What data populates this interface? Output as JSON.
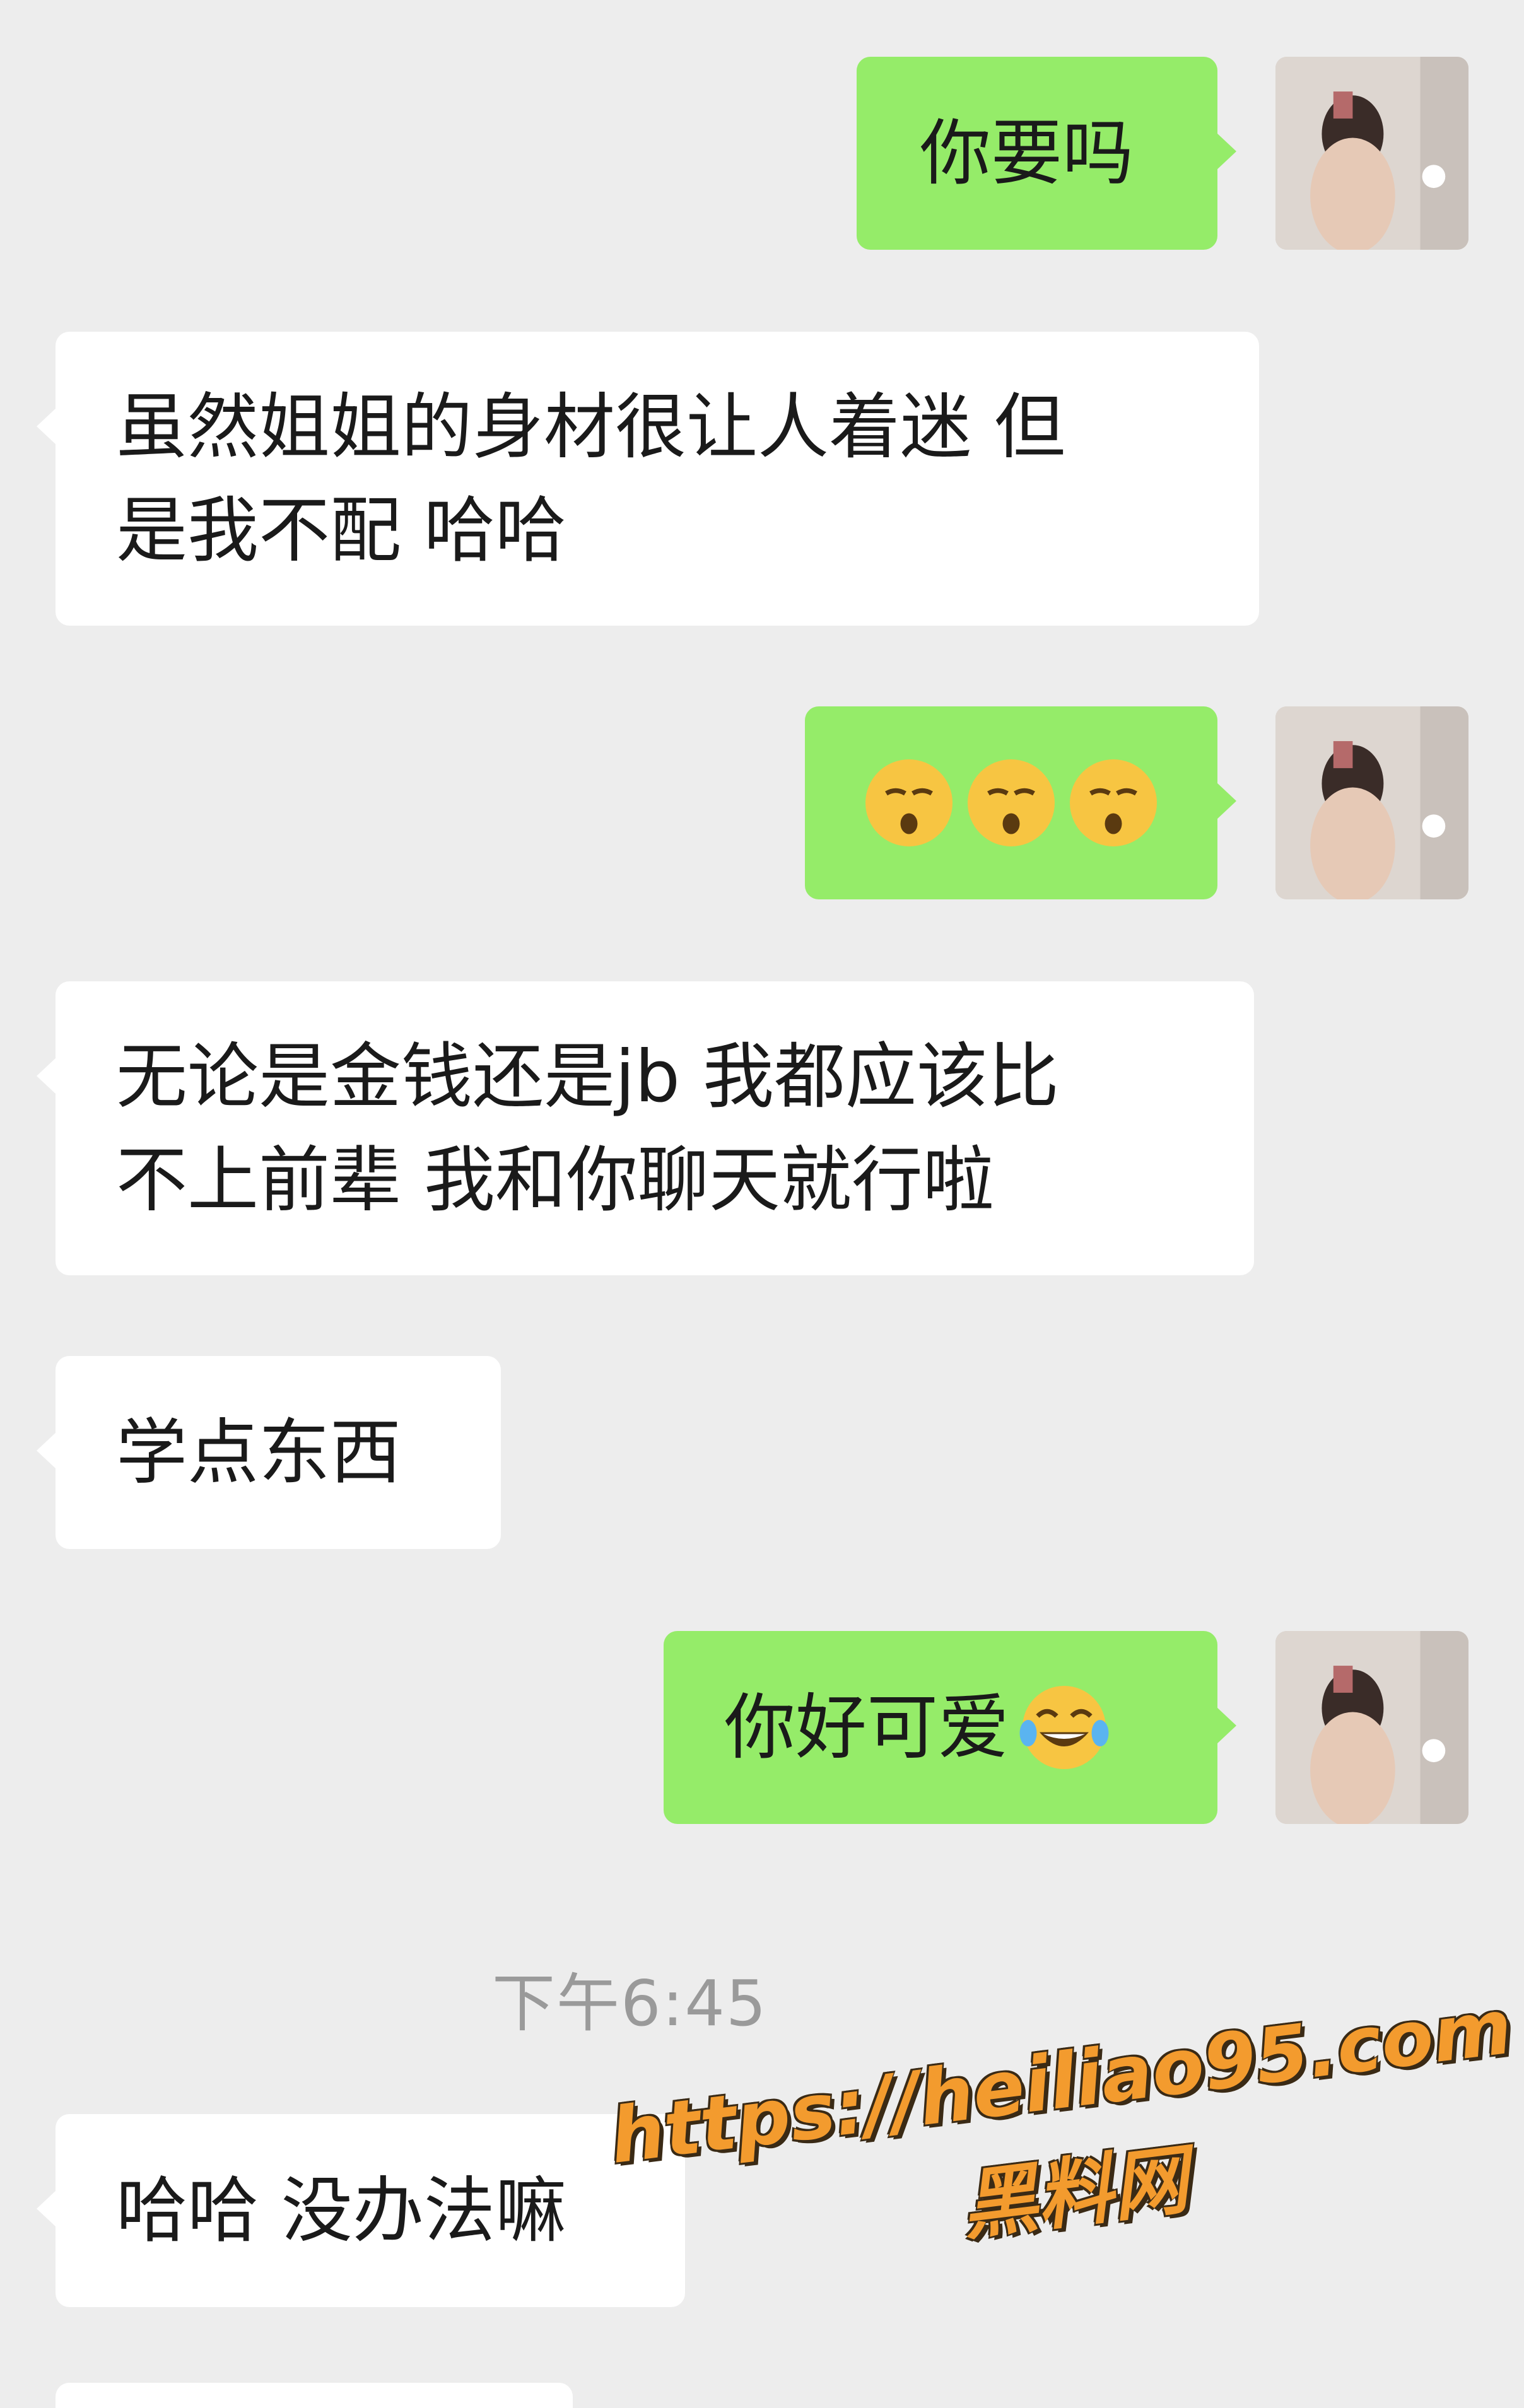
{
  "messages": [
    {
      "side": "out",
      "lines": [
        "你要吗"
      ]
    },
    {
      "side": "in",
      "lines": [
        "虽然姐姐的身材很让人着迷 但",
        "是我不配 哈哈"
      ]
    },
    {
      "side": "out",
      "emoji": [
        "sleepy-face-emoji",
        "sleepy-face-emoji",
        "sleepy-face-emoji"
      ]
    },
    {
      "side": "in",
      "lines": [
        "无论是金钱还是jb 我都应该比",
        "不上前辈 我和你聊天就行啦"
      ]
    },
    {
      "side": "in",
      "lines": [
        "学点东西"
      ]
    },
    {
      "side": "out",
      "lines": [
        "你好可爱"
      ],
      "emoji": [
        "tears-of-joy-emoji"
      ]
    },
    {
      "side": "in",
      "lines": [
        "哈哈 没办法嘛"
      ]
    }
  ],
  "timestamp": "下午6:45",
  "watermark": {
    "url": "https://heiliao95.com",
    "name": "黑料网"
  },
  "colors": {
    "background": "#ededed",
    "incoming_bubble": "#ffffff",
    "outgoing_bubble": "#95ec69",
    "watermark": "#f39b2e"
  }
}
